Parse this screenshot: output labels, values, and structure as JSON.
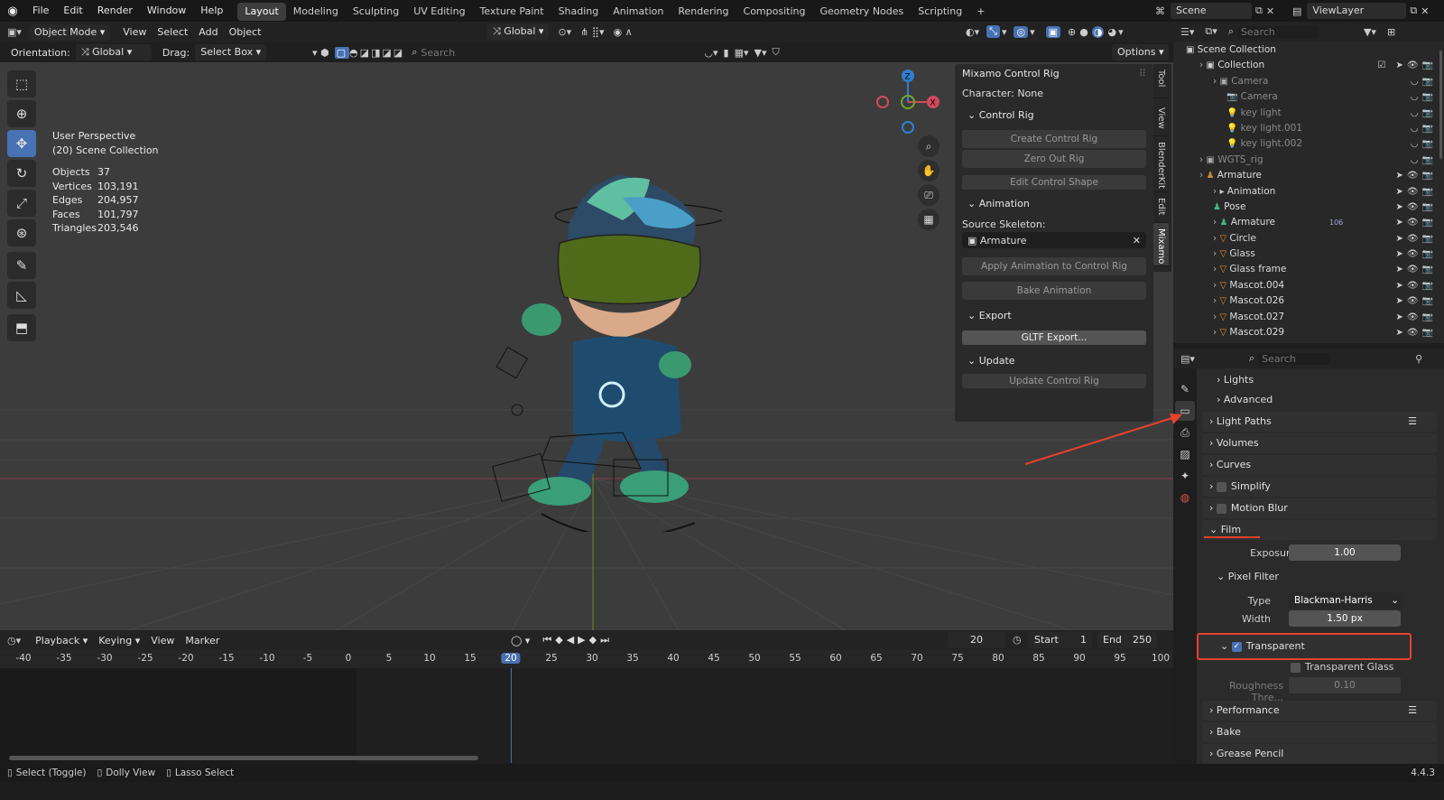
{
  "topbar": {
    "menus": [
      "File",
      "Edit",
      "Render",
      "Window",
      "Help"
    ],
    "workspaces": [
      "Layout",
      "Modeling",
      "Sculpting",
      "UV Editing",
      "Texture Paint",
      "Shading",
      "Animation",
      "Rendering",
      "Compositing",
      "Geometry Nodes",
      "Scripting"
    ],
    "active_workspace": "Layout",
    "add_tab": "+",
    "scene": "Scene",
    "view_layer": "ViewLayer"
  },
  "viewport_header": {
    "mode": "Object Mode",
    "menus": [
      "View",
      "Select",
      "Add",
      "Object"
    ],
    "transform": "Global",
    "orientation_label": "Orientation:",
    "orientation_value": "Global",
    "drag_label": "Drag:",
    "drag_value": "Select Box",
    "search_placeholder": "Search",
    "options": "Options"
  },
  "viewport": {
    "view_name": "User Perspective",
    "collection": "(20) Scene Collection",
    "stats": [
      {
        "label": "Objects",
        "value": "37"
      },
      {
        "label": "Vertices",
        "value": "103,191"
      },
      {
        "label": "Edges",
        "value": "204,957"
      },
      {
        "label": "Faces",
        "value": "101,797"
      },
      {
        "label": "Triangles",
        "value": "203,546"
      }
    ],
    "gizmo": {
      "x": "X",
      "y": "Y",
      "z": "Z"
    }
  },
  "npanel": {
    "title": "Mixamo Control Rig",
    "character": "Character: None",
    "control_rig_header": "Control Rig",
    "create_control_rig": "Create Control Rig",
    "zero_out_rig": "Zero Out Rig",
    "edit_control_shape": "Edit Control Shape",
    "animation_header": "Animation",
    "source_skeleton_label": "Source Skeleton:",
    "source_skeleton_value": "Armature",
    "apply_animation": "Apply Animation to Control Rig",
    "bake_animation": "Bake Animation",
    "export_header": "Export",
    "gltf_export": "GLTF Export...",
    "update_header": "Update",
    "update_control_rig": "Update Control Rig",
    "tabs": [
      "Tool",
      "View",
      "BlenderKit",
      "Edit",
      "Mixamo"
    ]
  },
  "timeline": {
    "menus": [
      "Playback",
      "Keying",
      "View",
      "Marker"
    ],
    "current_frame": "20",
    "start_label": "Start",
    "start_value": "1",
    "end_label": "End",
    "end_value": "250",
    "ticks": [
      "-40",
      "-35",
      "-30",
      "-25",
      "-20",
      "-15",
      "-10",
      "-5",
      "0",
      "5",
      "10",
      "15",
      "20",
      "25",
      "30",
      "35",
      "40",
      "45",
      "50",
      "55",
      "60",
      "65",
      "70",
      "75",
      "80",
      "85",
      "90",
      "95",
      "100"
    ],
    "playhead": "20"
  },
  "statusbar": {
    "select": "Select (Toggle)",
    "dolly": "Dolly View",
    "lasso": "Lasso Select",
    "version": "4.4.3"
  },
  "outliner": {
    "search_placeholder": "Search",
    "rows": [
      {
        "indent": 0,
        "label": "Scene Collection",
        "dim": false
      },
      {
        "indent": 1,
        "label": "Collection",
        "dim": false
      },
      {
        "indent": 2,
        "label": "Camera",
        "dim": true
      },
      {
        "indent": 3,
        "label": "Camera",
        "dim": true
      },
      {
        "indent": 3,
        "label": "key light",
        "dim": true
      },
      {
        "indent": 3,
        "label": "key light.001",
        "dim": true
      },
      {
        "indent": 3,
        "label": "key light.002",
        "dim": true
      },
      {
        "indent": 1,
        "label": "WGTS_rig",
        "dim": true
      },
      {
        "indent": 1,
        "label": "Armature",
        "dim": false
      },
      {
        "indent": 2,
        "label": "Animation",
        "dim": false
      },
      {
        "indent": 2,
        "label": "Pose",
        "dim": false
      },
      {
        "indent": 2,
        "label": "Armature",
        "dim": false
      },
      {
        "indent": 2,
        "label": "Circle",
        "dim": false
      },
      {
        "indent": 2,
        "label": "Glass",
        "dim": false
      },
      {
        "indent": 2,
        "label": "Glass frame",
        "dim": false
      },
      {
        "indent": 2,
        "label": "Mascot.004",
        "dim": false
      },
      {
        "indent": 2,
        "label": "Mascot.026",
        "dim": false
      },
      {
        "indent": 2,
        "label": "Mascot.027",
        "dim": false
      },
      {
        "indent": 2,
        "label": "Mascot.029",
        "dim": false
      }
    ],
    "armature_count": "106"
  },
  "properties": {
    "search_placeholder": "Search",
    "lights": "Lights",
    "advanced": "Advanced",
    "light_paths": "Light Paths",
    "volumes": "Volumes",
    "curves": "Curves",
    "simplify": "Simplify",
    "motion_blur": "Motion Blur",
    "film": "Film",
    "exposure_label": "Exposure",
    "exposure_value": "1.00",
    "pixel_filter": "Pixel Filter",
    "type_label": "Type",
    "type_value": "Blackman-Harris",
    "width_label": "Width",
    "width_value": "1.50 px",
    "transparent": "Transparent",
    "transparent_glass": "Transparent Glass",
    "roughness_label": "Roughness Thre...",
    "roughness_value": "0.10",
    "performance": "Performance",
    "bake": "Bake",
    "grease_pencil": "Grease Pencil"
  },
  "colors": {
    "accent": "#4772b3",
    "annotation": "#e8412c"
  }
}
